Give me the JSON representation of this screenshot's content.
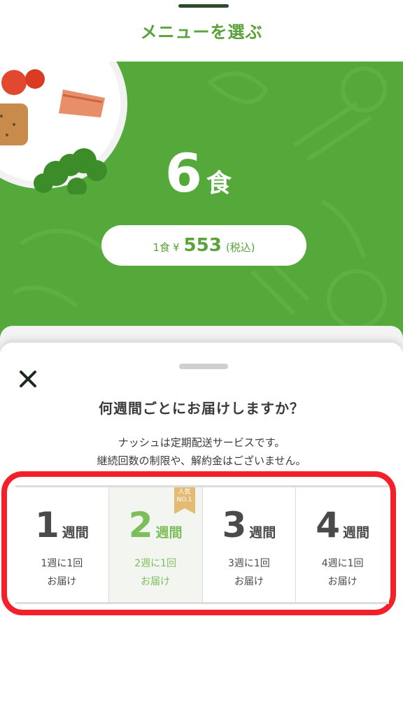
{
  "header": {
    "title": "メニューを選ぶ"
  },
  "hero": {
    "count": "6",
    "count_unit": "食",
    "price": {
      "label": "1食",
      "currency": "¥",
      "value": "553",
      "tax_note": "(税込)"
    },
    "colors": {
      "background": "#55a93a",
      "accent": "#5aa23a"
    }
  },
  "sheet": {
    "title": "何週間ごとにお届けしますか？",
    "description_line1": "ナッシュは定期配送サービスです。",
    "description_line2": "継続回数の制限や、解約金はございません。",
    "close_icon": "close-icon",
    "options": [
      {
        "number": "1",
        "unit": "週間",
        "line1": "1週に1回",
        "line2": "お届け",
        "selected": false
      },
      {
        "number": "2",
        "unit": "週間",
        "line1": "2週に1回",
        "line2": "お届け",
        "selected": true,
        "badge_line1": "人気",
        "badge_line2": "NO.1"
      },
      {
        "number": "3",
        "unit": "週間",
        "line1": "3週に1回",
        "line2": "お届け",
        "selected": false
      },
      {
        "number": "4",
        "unit": "週間",
        "line1": "4週に1回",
        "line2": "お届け",
        "selected": false
      }
    ],
    "highlight_color": "#f3202a"
  }
}
